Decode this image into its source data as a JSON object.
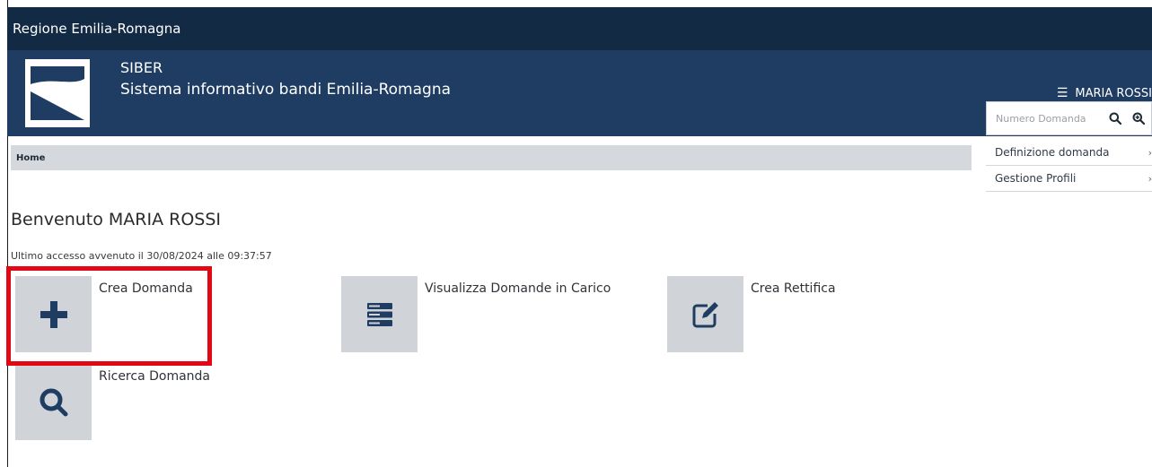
{
  "topbar": {
    "region": "Regione Emilia-Romagna"
  },
  "header": {
    "app_name": "SIBER",
    "app_full_name": "Sistema informativo bandi Emilia-Romagna",
    "user_name": "MARIA ROSSI",
    "logo_icon": "emilia-romagna-logo"
  },
  "search": {
    "placeholder": "Numero Domanda",
    "search_icon": "search-icon",
    "advanced_icon": "zoom-in-icon"
  },
  "side_menu": {
    "items": [
      {
        "label": "Definizione domanda"
      },
      {
        "label": "Gestione Profili"
      }
    ]
  },
  "breadcrumb": {
    "home": "Home"
  },
  "main": {
    "welcome": "Benvenuto MARIA ROSSI",
    "last_access": "Ultimo accesso avvenuto il 30/08/2024 alle 09:37:57",
    "tiles": [
      {
        "label": "Crea Domanda",
        "icon": "plus-icon"
      },
      {
        "label": "Visualizza Domande in Carico",
        "icon": "server-list-icon"
      },
      {
        "label": "Crea Rettifica",
        "icon": "edit-icon"
      },
      {
        "label": "Ricerca Domanda",
        "icon": "search-icon"
      }
    ]
  },
  "colors": {
    "topbar": "#132a44",
    "header": "#1f3d62",
    "tile_bg": "#d0d4d8",
    "icon": "#1f3d62",
    "highlight": "#e30613"
  }
}
